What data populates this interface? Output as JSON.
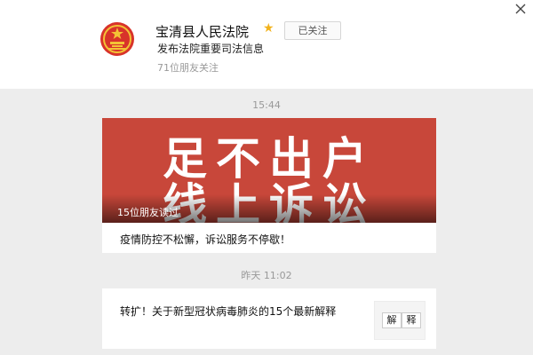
{
  "account": {
    "name": "宝清县人民法院",
    "follow_label": "已关注",
    "description": "发布法院重要司法信息",
    "followers": "71位朋友关注"
  },
  "feed": {
    "time1": "15:44",
    "card1": {
      "cover_line1": "足不出户",
      "cover_line2": "线上诉讼",
      "cover_caption": "15位朋友读过",
      "title": "疫情防控不松懈，诉讼服务不停歇！"
    },
    "time2": "昨天 11:02",
    "card2": {
      "title": "转扩！关于新型冠状病毒肺炎的15个最新解释",
      "thumb_chars": [
        "解",
        "释"
      ]
    }
  },
  "colors": {
    "cover": "#c8473a",
    "star": "#f2b21b",
    "emblem_red": "#d8332a",
    "emblem_gold": "#f3c235"
  },
  "icons": {
    "logo": "court-emblem-icon",
    "verified": "star-icon",
    "close": "close-icon"
  }
}
